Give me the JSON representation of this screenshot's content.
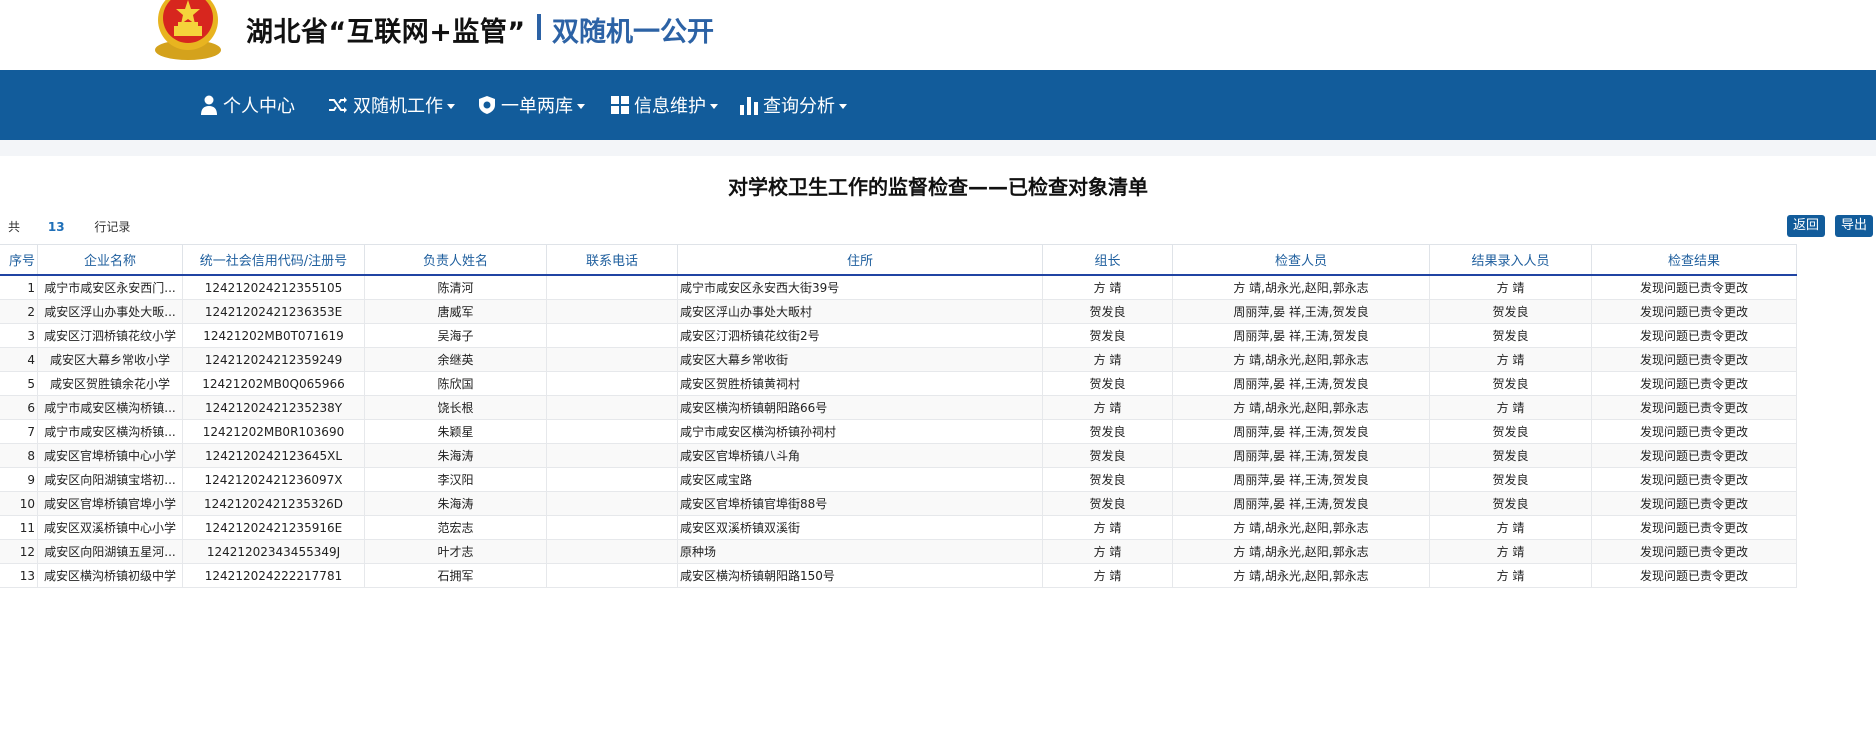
{
  "header": {
    "title": "湖北省“互联网+监管”",
    "subtitle": "双随机一公开"
  },
  "nav": {
    "items": [
      {
        "label": "个人中心",
        "icon": "user-icon"
      },
      {
        "label": "双随机工作",
        "icon": "shuffle-icon"
      },
      {
        "label": "一单两库",
        "icon": "shield-icon"
      },
      {
        "label": "信息维护",
        "icon": "grid-icon"
      },
      {
        "label": "查询分析",
        "icon": "bar-chart-icon"
      }
    ]
  },
  "page": {
    "title": "对学校卫生工作的监督检查——已检查对象清单",
    "count_prefix": "共",
    "count": "13",
    "count_suffix": "行记录",
    "back_label": "返回",
    "export_label": "导出"
  },
  "table": {
    "headers": [
      "序号",
      "企业名称",
      "统一社会信用代码/注册号",
      "负责人姓名",
      "联系电话",
      "住所",
      "组长",
      "检查人员",
      "结果录入人员",
      "检查结果"
    ],
    "rows": [
      [
        "1",
        "咸宁市咸安区永安西门...",
        "12421202421235510​5",
        "陈清河",
        "",
        "咸宁市咸安区永安西大街39号",
        "方 靖",
        "方 靖,胡永光,赵阳,郭永志",
        "方 靖",
        "发现问题已责令更改"
      ],
      [
        "2",
        "咸安区浮山办事处大畈...",
        "124212024212363​53E",
        "唐威军",
        "",
        "咸安区浮山办事处大畈村",
        "贺发良",
        "周丽萍,晏 祥,王涛,贺发良",
        "贺发良",
        "发现问题已责令更改"
      ],
      [
        "3",
        "咸安区汀泗桥镇花纹小学",
        "12421202MB0T071619",
        "吴海子",
        "",
        "咸安区汀泗桥镇花纹街2号",
        "贺发良",
        "周丽萍,晏 祥,王涛,贺发良",
        "贺发良",
        "发现问题已责令更改"
      ],
      [
        "4",
        "咸安区大幕乡常收小学",
        "124212024212359249",
        "余继英",
        "",
        "咸安区大幕乡常收街",
        "方 靖",
        "方 靖,胡永光,赵阳,郭永志",
        "方 靖",
        "发现问题已责令更改"
      ],
      [
        "5",
        "咸安区贺胜镇余花小学",
        "12421202MB0Q065966",
        "陈欣国",
        "",
        "咸安区贺胜桥镇黄祠村",
        "贺发良",
        "周丽萍,晏 祥,王涛,贺发良",
        "贺发良",
        "发现问题已责令更改"
      ],
      [
        "6",
        "咸宁市咸安区横沟桥镇...",
        "12421202421235238Y",
        "饶长根",
        "",
        "咸安区横沟桥镇朝阳路66号",
        "方 靖",
        "方 靖,胡永光,赵阳,郭永志",
        "方 靖",
        "发现问题已责令更改"
      ],
      [
        "7",
        "咸宁市咸安区横沟桥镇...",
        "12421202MB0R103690",
        "朱颖星",
        "",
        "咸宁市咸安区横沟桥镇孙祠村",
        "贺发良",
        "周丽萍,晏 祥,王涛,贺发良",
        "贺发良",
        "发现问题已责令更改"
      ],
      [
        "8",
        "咸安区官埠桥镇中心小学",
        "124212024212364​5XL",
        "朱海涛",
        "",
        "咸安区官埠桥镇八斗角",
        "贺发良",
        "周丽萍,晏 祥,王涛,贺发良",
        "贺发良",
        "发现问题已责令更改"
      ],
      [
        "9",
        "咸安区向阳湖镇宝塔初...",
        "12421202421236097X",
        "李汉阳",
        "",
        "咸安区咸宝路",
        "贺发良",
        "周丽萍,晏 祥,王涛,贺发良",
        "贺发良",
        "发现问题已责令更改"
      ],
      [
        "10",
        "咸安区官埠桥镇官埠小学",
        "12421202421235326D",
        "朱海涛",
        "",
        "咸安区官埠桥镇官埠街88号",
        "贺发良",
        "周丽萍,晏 祥,王涛,贺发良",
        "贺发良",
        "发现问题已责令更改"
      ],
      [
        "11",
        "咸安区双溪桥镇中心小学",
        "12421202421235916E",
        "范宏志",
        "",
        "咸安区双溪桥镇双溪街",
        "方 靖",
        "方 靖,胡永光,赵阳,郭永志",
        "方 靖",
        "发现问题已责令更改"
      ],
      [
        "12",
        "咸安区向阳湖镇五星河...",
        "12421202343455349J",
        "叶才志",
        "",
        "原种场",
        "方 靖",
        "方 靖,胡永光,赵阳,郭永志",
        "方 靖",
        "发现问题已责令更改"
      ],
      [
        "13",
        "咸安区横沟桥镇初级中学",
        "124212024222217781",
        "石拥军",
        "",
        "咸安区横沟桥镇朝阳路150号",
        "方 靖",
        "方 靖,胡永光,赵阳,郭永志",
        "方 靖",
        "发现问题已责令更改"
      ]
    ]
  }
}
